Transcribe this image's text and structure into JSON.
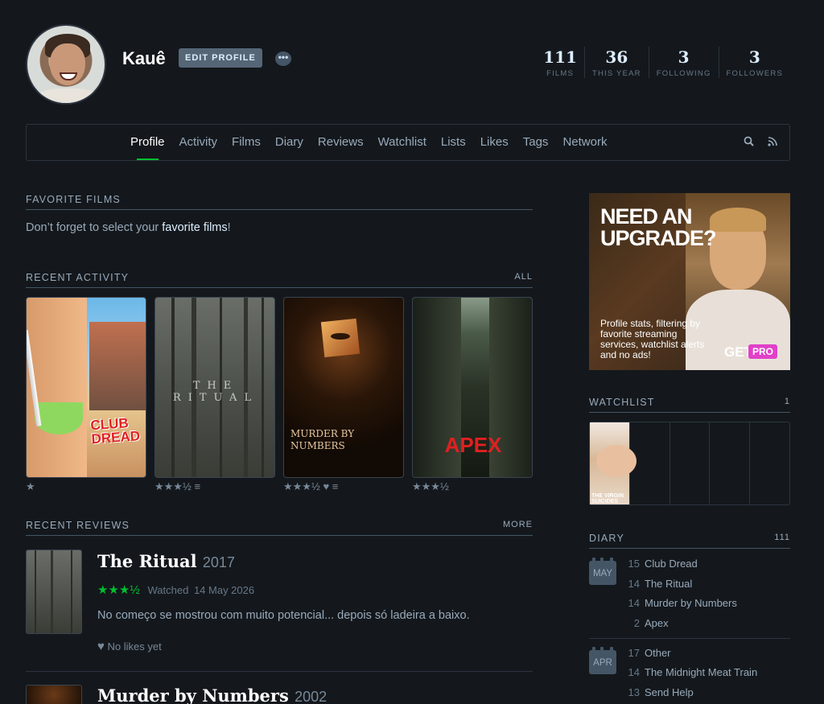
{
  "profile": {
    "username": "Kauê",
    "edit_label": "EDIT PROFILE",
    "more_label": "•••",
    "stats": [
      {
        "num": "111",
        "label": "FILMS"
      },
      {
        "num": "36",
        "label": "THIS YEAR"
      },
      {
        "num": "3",
        "label": "FOLLOWING"
      },
      {
        "num": "3",
        "label": "FOLLOWERS"
      }
    ]
  },
  "nav": {
    "items": [
      "Profile",
      "Activity",
      "Films",
      "Diary",
      "Reviews",
      "Watchlist",
      "Lists",
      "Likes",
      "Tags",
      "Network"
    ]
  },
  "favorites": {
    "heading": "FAVORITE FILMS",
    "text_before": "Don’t forget to select your ",
    "link": "favorite films",
    "text_after": "!"
  },
  "activity": {
    "heading": "RECENT ACTIVITY",
    "all_label": "ALL",
    "films": [
      {
        "title": "CLUB DREAD",
        "rating": "★",
        "extra": ""
      },
      {
        "title": "THE RITUAL",
        "rating": "★★★½",
        "extra": "≡"
      },
      {
        "title": "MURDER BY NUMBERS",
        "rating": "★★★½",
        "extra": "♥ ≡"
      },
      {
        "title": "APEX",
        "rating": "★★★½",
        "extra": ""
      }
    ]
  },
  "reviews": {
    "heading": "RECENT REVIEWS",
    "more_label": "MORE",
    "items": [
      {
        "title": "The Ritual",
        "year": "2017",
        "stars": "★★★½",
        "watched": "Watched",
        "date": "14 May 2026",
        "text": "No começo se mostrou com muito potencial... depois só ladeira a baixo.",
        "likes": "No likes yet"
      },
      {
        "title": "Murder by Numbers",
        "year": "2002"
      }
    ]
  },
  "ad": {
    "headline_1": "NEED AN",
    "headline_2": "UPGRADE?",
    "body": "Profile stats, filtering by favorite streaming services, watchlist alerts and no ads!",
    "get": "GET",
    "pro": "PRO"
  },
  "watchlist": {
    "heading": "WATCHLIST",
    "count": "1",
    "first_title": "THE VIRGIN SUICIDES"
  },
  "diary": {
    "heading": "DIARY",
    "count": "111",
    "months": [
      {
        "month": "MAY",
        "entries": [
          {
            "day": "15",
            "title": "Club Dread"
          },
          {
            "day": "14",
            "title": "The Ritual"
          },
          {
            "day": "14",
            "title": "Murder by Numbers"
          },
          {
            "day": "2",
            "title": "Apex"
          }
        ]
      },
      {
        "month": "APR",
        "entries": [
          {
            "day": "17",
            "title": "Other"
          },
          {
            "day": "14",
            "title": "The Midnight Meat Train"
          },
          {
            "day": "13",
            "title": "Send Help"
          }
        ]
      }
    ]
  },
  "colors": {
    "background": "#14181c",
    "accent_green": "#00c030",
    "pro_pink": "#e040c8"
  }
}
